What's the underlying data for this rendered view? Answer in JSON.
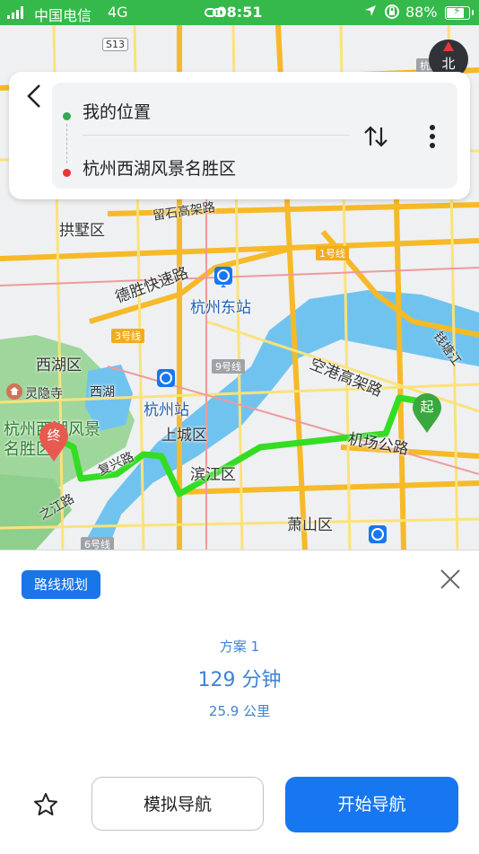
{
  "status_bar": {
    "carrier": "中国电信",
    "network": "4G",
    "time": "08:51",
    "battery_percent": "88%",
    "battery_level": 0.88
  },
  "map": {
    "labels": {
      "s13": "S13",
      "hanghai": "杭海城际",
      "liushi": "留石高架路",
      "gongshu": "拱墅区",
      "line1": "1号线",
      "desheng": "德胜快速路",
      "hangzhou_east": "杭州东站",
      "line3": "3号线",
      "qiantang_river": "钱塘江",
      "xihu_district": "西湖区",
      "line9": "9号线",
      "konggang": "空港高架路",
      "lingyin": "灵隐寺",
      "xihu": "西湖",
      "hangzhou_station": "杭州站",
      "shangcheng": "上城区",
      "airport_rd": "机场公路",
      "scenic_area": "杭州西湖风景名胜区",
      "fuxing": "复兴路",
      "binjiang": "滨江区",
      "zhijiang": "之江路",
      "xiaoshan": "萧山区",
      "line6": "6号线"
    },
    "start_marker": "起",
    "end_marker": "终",
    "compass": "北",
    "colors": {
      "route": "#33dd22",
      "water": "#70c3ef",
      "park": "#9ed69b",
      "highway": "#f6b928",
      "road": "#fbe27a"
    }
  },
  "route_panel": {
    "from": "我的位置",
    "to": "杭州西湖风景名胜区"
  },
  "sheet": {
    "tag": "路线规划",
    "plan_name": "方案 1",
    "plan_time": "129 分钟",
    "plan_distance": "25.9 公里",
    "simulate_button": "模拟导航",
    "start_button": "开始导航",
    "accent": "#1677f0"
  }
}
